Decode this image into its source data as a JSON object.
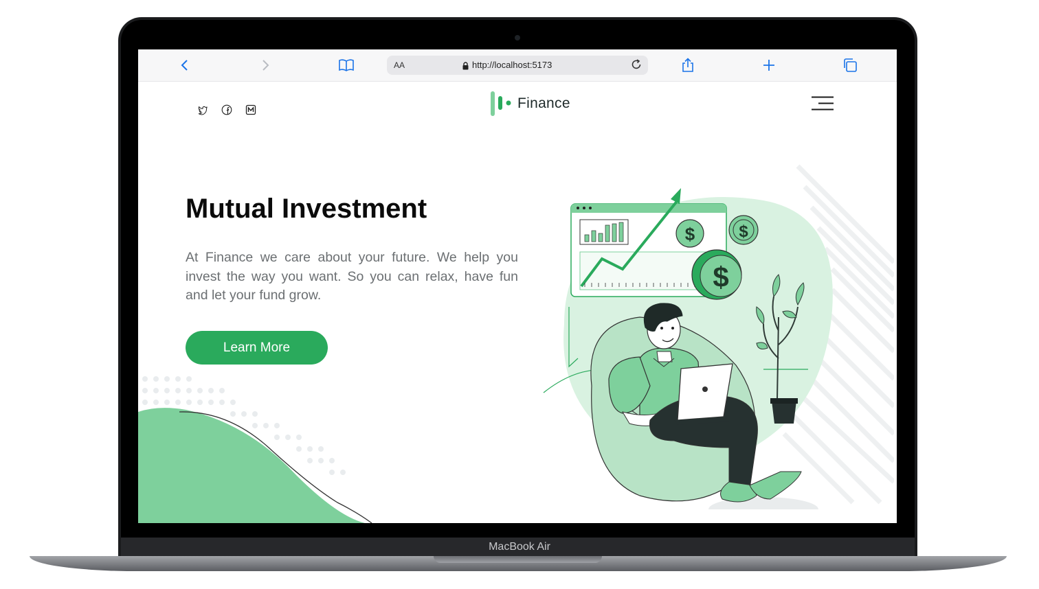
{
  "device": {
    "model_label": "MacBook Air"
  },
  "browser": {
    "aa_label": "AA",
    "url": "http://localhost:5173",
    "icons": [
      "back-icon",
      "forward-icon",
      "bookmarks-icon",
      "lock-icon",
      "reload-icon",
      "share-icon",
      "new-tab-icon",
      "tabs-icon"
    ]
  },
  "header": {
    "social_icons": [
      "twitter-icon",
      "facebook-icon",
      "medium-icon"
    ],
    "logo_text": "Finance",
    "menu_icon": "hamburger-menu-icon"
  },
  "hero": {
    "title": "Mutual Investment",
    "description": "At Finance we care about your future. We help you invest the way you want. So you can relax, have fun and let your fund grow.",
    "cta_label": "Learn More"
  },
  "colors": {
    "brand_green": "#2aaa5c",
    "light_green": "#7ed09c",
    "pale_green": "#d9f2e1",
    "browser_blue": "#1a73e8"
  }
}
